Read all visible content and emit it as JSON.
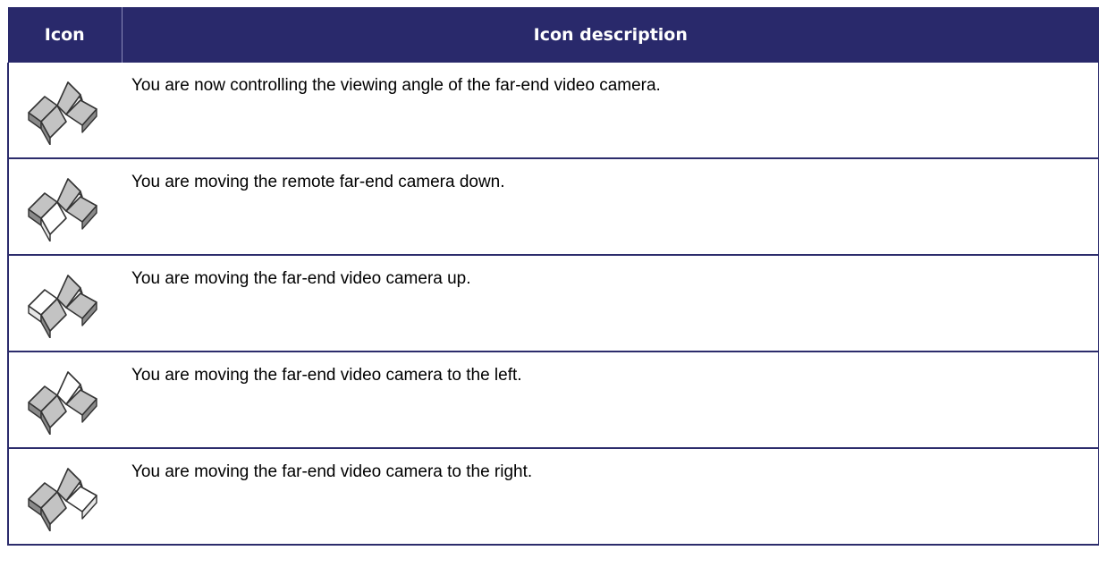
{
  "table": {
    "header": {
      "icon": "Icon",
      "description": "Icon description"
    },
    "rows": [
      {
        "icon": "camera-control-active-icon",
        "highlight": "none",
        "description": "You are now controlling the viewing angle of the far-end video camera."
      },
      {
        "icon": "camera-control-down-icon",
        "highlight": "down",
        "description": "You are moving the remote far-end camera down."
      },
      {
        "icon": "camera-control-up-icon",
        "highlight": "up",
        "description": "You are moving the far-end video camera up."
      },
      {
        "icon": "camera-control-left-icon",
        "highlight": "left",
        "description": "You are moving the far-end video camera to the left."
      },
      {
        "icon": "camera-control-right-icon",
        "highlight": "right",
        "description": "You are moving the far-end video camera to the right."
      }
    ]
  },
  "colors": {
    "header_bg": "#29296b",
    "header_text": "#ffffff",
    "border": "#2c2c6c",
    "petal_fill": "#c3c3c3",
    "petal_side": "#8a8a8a",
    "highlight_fill": "#ffffff"
  }
}
